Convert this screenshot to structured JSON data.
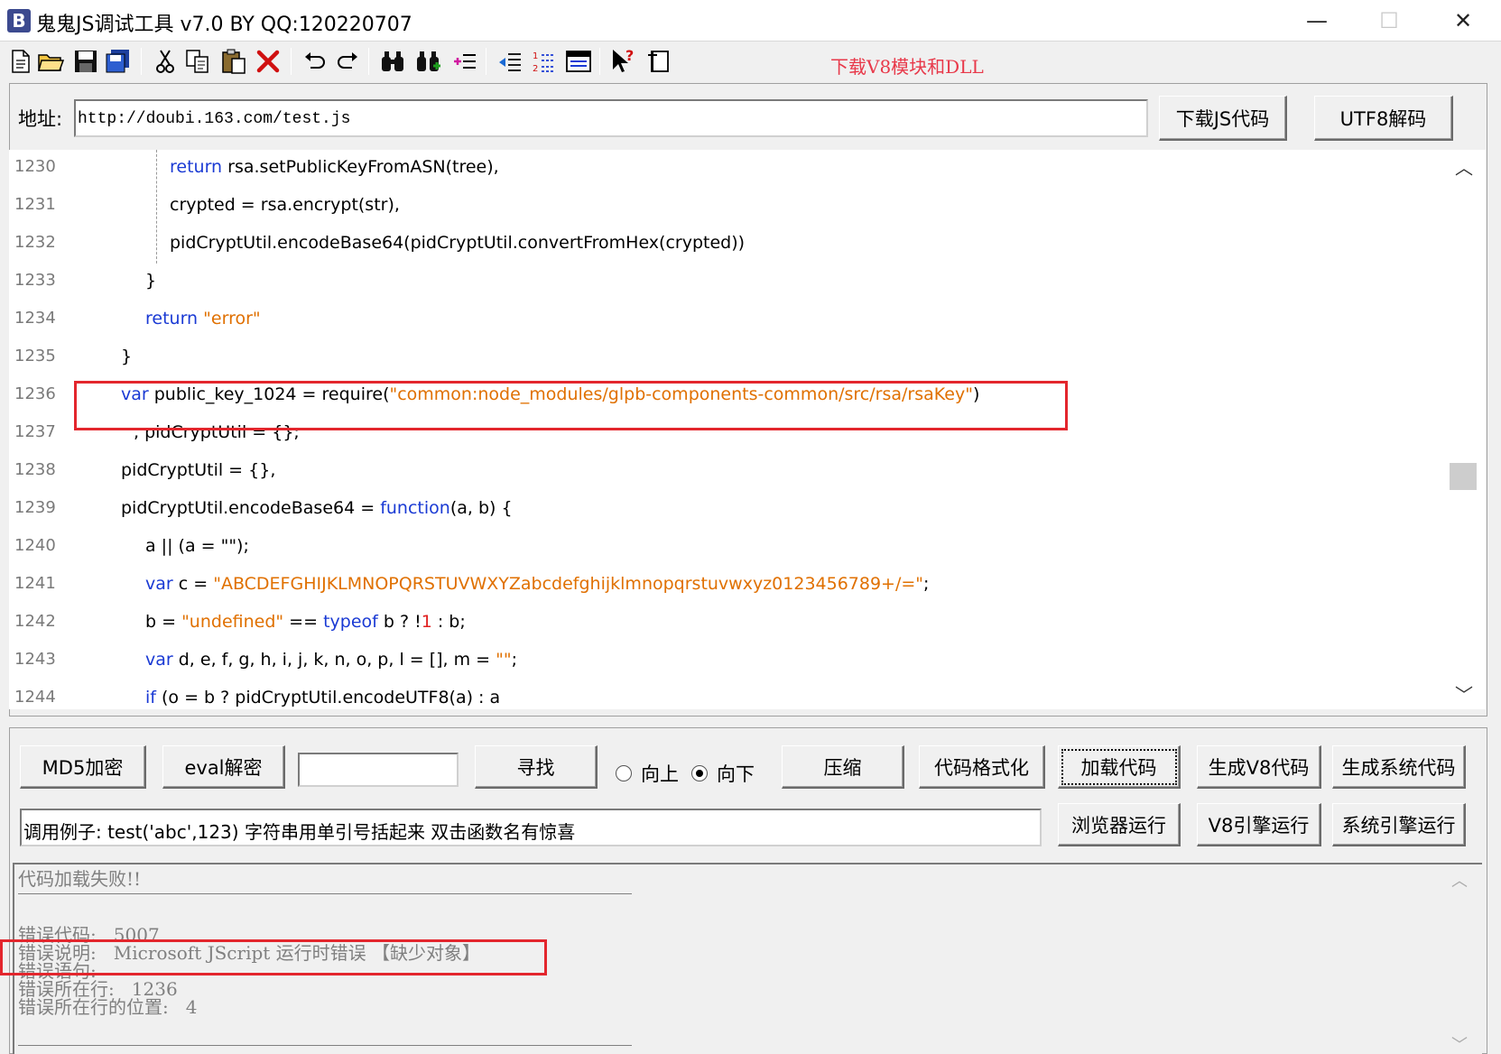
{
  "window": {
    "app_icon": "B",
    "title": "鬼鬼JS调试工具 v7.0 BY QQ:120220707",
    "minimize": "—",
    "maximize": "☐",
    "close": "✕"
  },
  "toolbar": {
    "icons": [
      "new-file-icon",
      "open-folder-icon",
      "save-icon",
      "save-all-icon",
      "cut-icon",
      "copy-icon",
      "paste-icon",
      "delete-icon",
      "undo-icon",
      "redo-icon",
      "find-icon",
      "find-next-icon",
      "list-icon",
      "indent-icon",
      "numbered-list-icon",
      "window-icon",
      "help-cursor-icon",
      "panel-icon"
    ],
    "download_v8_link": "下载V8模块和DLL"
  },
  "address": {
    "label": "地址:",
    "value": "http://doubi.163.com/test.js",
    "download_button": "下载JS代码",
    "utf8_button": "UTF8解码"
  },
  "code": {
    "lines": [
      {
        "num": "1230",
        "text": "return rsa.setPublicKeyFromASN(tree),"
      },
      {
        "num": "1231",
        "text": "crypted = rsa.encrypt(str),"
      },
      {
        "num": "1232",
        "text": "pidCryptUtil.encodeBase64(pidCryptUtil.convertFromHex(crypted))"
      },
      {
        "num": "1233",
        "text": "}"
      },
      {
        "num": "1234",
        "text": "return \"error\""
      },
      {
        "num": "1235",
        "text": "}"
      },
      {
        "num": "1236",
        "text": "var public_key_1024 = require(\"common:node_modules/glpb-components-common/src/rsa/rsaKey\")"
      },
      {
        "num": "1237",
        "text": ", pidCryptUtil = {};"
      },
      {
        "num": "1238",
        "text": "pidCryptUtil = {},"
      },
      {
        "num": "1239",
        "text": "pidCryptUtil.encodeBase64 = function(a, b) {"
      },
      {
        "num": "1240",
        "text": "a || (a = \"\");"
      },
      {
        "num": "1241",
        "text": "var c = \"ABCDEFGHIJKLMNOPQRSTUVWXYZabcdefghijklmnopqrstuvwxyz0123456789+/=\";"
      },
      {
        "num": "1242",
        "text": "b = \"undefined\" == typeof b ? !1 : b;"
      },
      {
        "num": "1243",
        "text": "var d, e, f, g, h, i, j, k, n, o, p, l = [], m = \"\";"
      },
      {
        "num": "1244",
        "text": "if (o = b ? pidCryptUtil.encodeUTF8(a) : a"
      }
    ]
  },
  "controls": {
    "md5_button": "MD5加密",
    "eval_button": "eval解密",
    "search_value": "",
    "find_button": "寻找",
    "radio_up": "向上",
    "radio_down": "向下",
    "radio_selected": "down",
    "compress_button": "压缩",
    "format_button": "代码格式化",
    "load_button": "加载代码",
    "gen_v8_button": "生成V8代码",
    "gen_sys_button": "生成系统代码",
    "example_text": "调用例子: test('abc',123) 字符串用单引号括起来 双击函数名有惊喜",
    "browser_run_button": "浏览器运行",
    "v8_run_button": "V8引擎运行",
    "sys_run_button": "系统引擎运行"
  },
  "output": {
    "heading": "代码加载失败!!",
    "error_code": "错误代码:   5007",
    "error_desc": "错误说明:   Microsoft JScript 运行时错误 【缺少对象】",
    "error_stmt": "错误语句:",
    "error_line": "错误所在行:   1236",
    "error_pos": "错误所在行的位置:   4"
  },
  "colors": {
    "keyword": "#1a3ad4",
    "string": "#e07000",
    "highlight_box": "#e3262d",
    "download_link": "#e8394a"
  }
}
